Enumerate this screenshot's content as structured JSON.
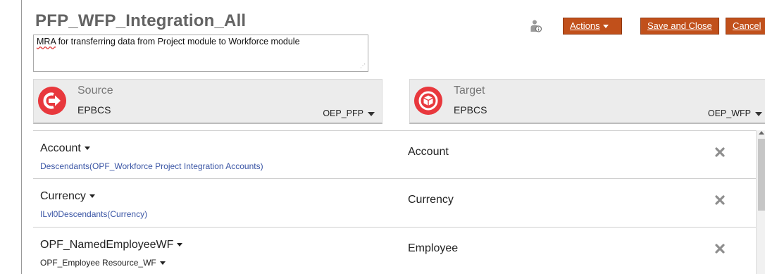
{
  "header": {
    "title": "PFP_WFP_Integration_All",
    "description_first": "MRA",
    "description_rest": " for transferring data from Project module to Workforce module",
    "actions_label": "Actions",
    "save_close_label": "Save and Close",
    "cancel_label": "Cancel"
  },
  "source": {
    "label": "Source",
    "type": "EPBCS",
    "app": "OEP_PFP",
    "icon": "exit-arrow-icon",
    "color": "#e8383d"
  },
  "target": {
    "label": "Target",
    "type": "EPBCS",
    "app": "OEP_WFP",
    "icon": "target-cube-icon",
    "color": "#e8383d"
  },
  "mappings": [
    {
      "source": "Account",
      "expression": "Descendants(OPF_Workforce Project Integration Accounts)",
      "target": "Account"
    },
    {
      "source": "Currency",
      "expression": "ILvl0Descendants(Currency)",
      "target": "Currency"
    },
    {
      "source": "OPF_NamedEmployeeWF",
      "expression": "OPF_Employee Resource_WF",
      "target": "Employee"
    }
  ],
  "colors": {
    "accent_button": "#c1501b",
    "expression_link": "#3a55a5"
  }
}
